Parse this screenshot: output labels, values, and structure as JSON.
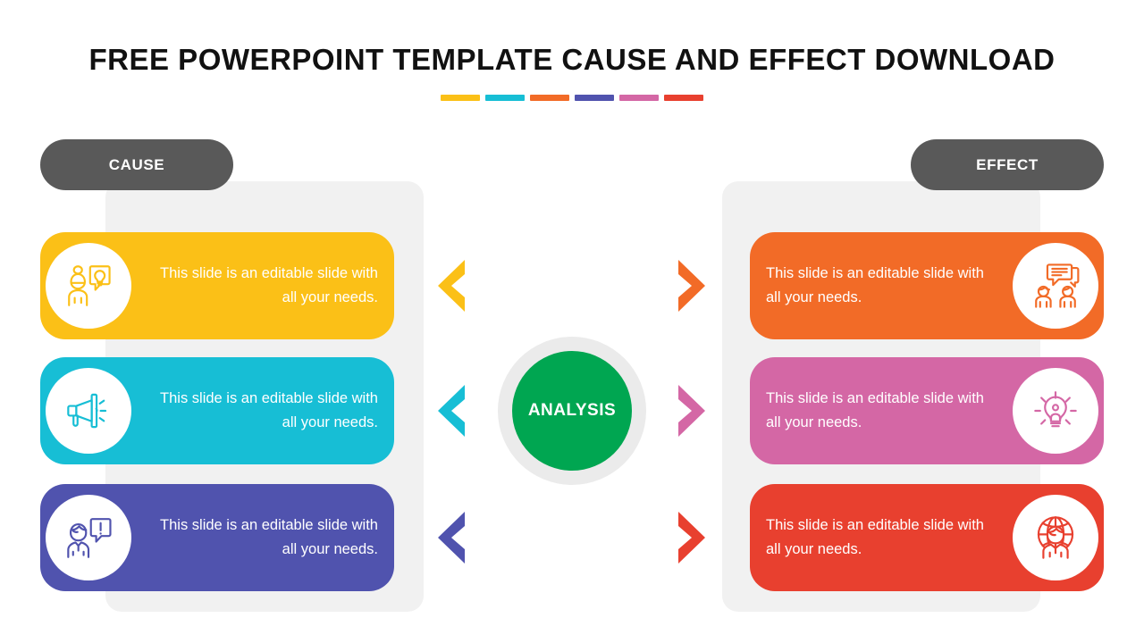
{
  "slide": {
    "title": "FREE POWERPOINT TEMPLATE CAUSE AND EFFECT DOWNLOAD",
    "background": "#ffffff"
  },
  "accent_bars": [
    {
      "name": "accent-bar-yellow",
      "color": "#FBC017"
    },
    {
      "name": "accent-bar-cyan",
      "color": "#17BED5"
    },
    {
      "name": "accent-bar-orange",
      "color": "#F26B27"
    },
    {
      "name": "accent-bar-indigo",
      "color": "#5053AE"
    },
    {
      "name": "accent-bar-pink",
      "color": "#D467A5"
    },
    {
      "name": "accent-bar-red",
      "color": "#E8402F"
    }
  ],
  "headers": {
    "cause_label": "CAUSE",
    "effect_label": "EFFECT",
    "pill_color": "#595959",
    "pill_text_color": "#ffffff"
  },
  "center": {
    "label": "ANALYSIS",
    "circle_color": "#00a651",
    "ring_color": "#ebebeb",
    "text_color": "#ffffff"
  },
  "panels": {
    "color": "#f1f1f1"
  },
  "cause_cards": [
    {
      "text": "This slide is an editable slide with all your needs.",
      "color": "#FBC017",
      "icon": "woman-idea-bubble-icon",
      "arrow": "chevron-left-icon",
      "arrow_color": "#FBC017"
    },
    {
      "text": "This slide is an editable slide with all your needs.",
      "color": "#17BED5",
      "icon": "megaphone-icon",
      "arrow": "chevron-left-icon",
      "arrow_color": "#17BED5"
    },
    {
      "text": "This slide is an editable slide with all your needs.",
      "color": "#5053AE",
      "icon": "man-alert-bubble-icon",
      "arrow": "chevron-left-icon",
      "arrow_color": "#5053AE"
    }
  ],
  "effect_cards": [
    {
      "text": "This slide is an editable slide with all your needs.",
      "color": "#F26B27",
      "icon": "people-chat-icon",
      "arrow": "chevron-right-icon",
      "arrow_color": "#F26B27"
    },
    {
      "text": "This slide is an editable slide with all your needs.",
      "color": "#D467A5",
      "icon": "lightbulb-person-icon",
      "arrow": "chevron-right-icon",
      "arrow_color": "#D467A5"
    },
    {
      "text": "This slide is an editable slide with all your needs.",
      "color": "#E8402F",
      "icon": "globe-person-icon",
      "arrow": "chevron-right-icon",
      "arrow_color": "#E8402F"
    }
  ]
}
